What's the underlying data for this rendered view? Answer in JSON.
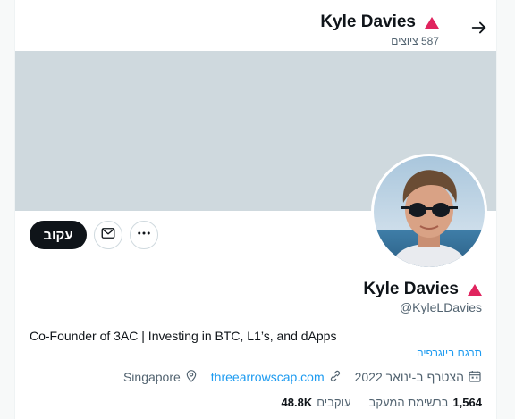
{
  "header": {
    "name": "Kyle Davies",
    "tweet_count": "587 ציוצים",
    "back_icon": "arrow-right-icon"
  },
  "banner": {
    "color": "#cfd9de"
  },
  "profile": {
    "name": "Kyle Davies",
    "handle": "@KyleLDavies",
    "bio": "Co-Founder of 3AC | Investing in BTC, L1’s, and dApps",
    "translate_bio": "תרגם ביוגרפיה",
    "joined": "הצטרף ב-ינואר 2022",
    "website": "threearrowscap.com",
    "location": "Singapore",
    "following_count": "1,564",
    "following_label": "ברשימת המעקב",
    "followers_count": "48.8K",
    "followers_label": "עוקבים"
  },
  "actions": {
    "follow_label": "עקוב",
    "message_icon": "envelope-icon",
    "more_icon": "more-dots-icon"
  },
  "colors": {
    "accent": "#1d9bf0",
    "badge": "#e0245e",
    "text": "#0f1419",
    "muted": "#536471"
  }
}
